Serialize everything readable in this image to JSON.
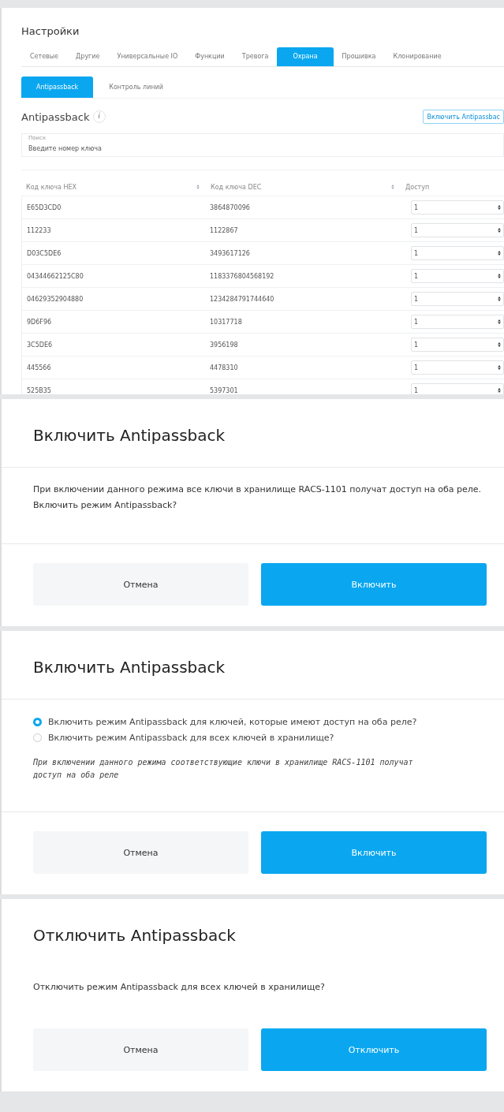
{
  "settings": {
    "title": "Настройки",
    "tabs": [
      {
        "label": "Сетевые",
        "selected": false
      },
      {
        "label": "Другие",
        "selected": false
      },
      {
        "label": "Универсальные IO",
        "selected": false
      },
      {
        "label": "Функции",
        "selected": false
      },
      {
        "label": "Тревога",
        "selected": false
      },
      {
        "label": "Охрана",
        "selected": true
      },
      {
        "label": "Прошивка",
        "selected": false
      },
      {
        "label": "Клонирование",
        "selected": false
      }
    ],
    "subtabs": [
      {
        "label": "Antipassback",
        "selected": true
      },
      {
        "label": "Контроль линий",
        "selected": false
      }
    ],
    "section_title": "Antipassback",
    "info": "i",
    "enable_button": "Включить Antipassbac",
    "search": {
      "label": "Поиск",
      "placeholder": "Введите номер ключа"
    },
    "table": {
      "columns": [
        {
          "label": "Код ключа HEX",
          "sortable": true
        },
        {
          "label": "Код ключа DEC",
          "sortable": true
        },
        {
          "label": "Доступ",
          "sortable": false
        }
      ],
      "rows": [
        {
          "hex": "E65D3CD0",
          "dec": "3864870096",
          "access": "1"
        },
        {
          "hex": "112233",
          "dec": "1122867",
          "access": "1"
        },
        {
          "hex": "D03C5DE6",
          "dec": "3493617126",
          "access": "1"
        },
        {
          "hex": "04344662125C80",
          "dec": "1183376804568192",
          "access": "1"
        },
        {
          "hex": "04629352904880",
          "dec": "1234284791744640",
          "access": "1"
        },
        {
          "hex": "9D6F96",
          "dec": "10317718",
          "access": "1"
        },
        {
          "hex": "3C5DE6",
          "dec": "3956198",
          "access": "1"
        },
        {
          "hex": "445566",
          "dec": "4478310",
          "access": "1"
        },
        {
          "hex": "525B35",
          "dec": "5397301",
          "access": "1"
        }
      ]
    }
  },
  "dialogs": [
    {
      "kind": "message",
      "title": "Включить Antipassback",
      "dividers": true,
      "text": "При включении данного режима все ключи в хранилище RACS-1101 получат доступ на оба реле. Включить режим Antipassback?",
      "buttons": [
        {
          "label": "Отмена",
          "primary": false
        },
        {
          "label": "Включить",
          "primary": true
        }
      ]
    },
    {
      "kind": "options",
      "title": "Включить Antipassback",
      "dividers": true,
      "options": [
        {
          "label": "Включить режим Antipassback для ключей, которые имеют доступ на оба реле?",
          "selected": true
        },
        {
          "label": "Включить режим Antipassback для всех ключей в хранилище?",
          "selected": false
        }
      ],
      "note": "При включении данного режима соответствующие ключи в хранилище RACS-1101 получат доступ на оба реле",
      "buttons": [
        {
          "label": "Отмена",
          "primary": false
        },
        {
          "label": "Включить",
          "primary": true
        }
      ]
    },
    {
      "kind": "message",
      "title": "Отключить Antipassback",
      "dividers": false,
      "text": "Отключить режим Antipassback для всех ключей в хранилище?",
      "buttons": [
        {
          "label": "Отмена",
          "primary": false
        },
        {
          "label": "Отключить",
          "primary": true
        }
      ]
    }
  ]
}
